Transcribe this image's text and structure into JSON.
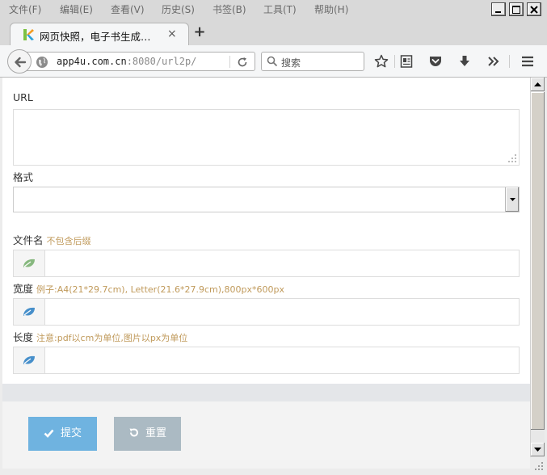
{
  "menu": {
    "items": [
      "文件(F)",
      "编辑(E)",
      "查看(V)",
      "历史(S)",
      "书签(B)",
      "工具(T)",
      "帮助(H)"
    ]
  },
  "tab": {
    "title": "网页快照，电子书生成…",
    "close": "×"
  },
  "newtab": {
    "label": "+"
  },
  "address": {
    "host": "app4u.com.cn",
    "rest": ":8080/url2p/"
  },
  "search": {
    "placeholder": "搜索"
  },
  "form": {
    "url_label": "URL",
    "format_label": "格式",
    "filename_label": "文件名",
    "filename_hint": "不包含后缀",
    "width_label": "宽度",
    "width_hint": "例子:A4(21*29.7cm), Letter(21.6*27.9cm),800px*600px",
    "height_label": "长度",
    "height_hint": "注意:pdf以cm为单位,图片以px为单位",
    "submit_label": "提交",
    "reset_label": "重置"
  },
  "colors": {
    "hint": "#c09a5b",
    "submit": "#6fb3e0",
    "reset": "#abbac3",
    "leaf_green": "#87b87f",
    "leaf_blue": "#478fca"
  }
}
